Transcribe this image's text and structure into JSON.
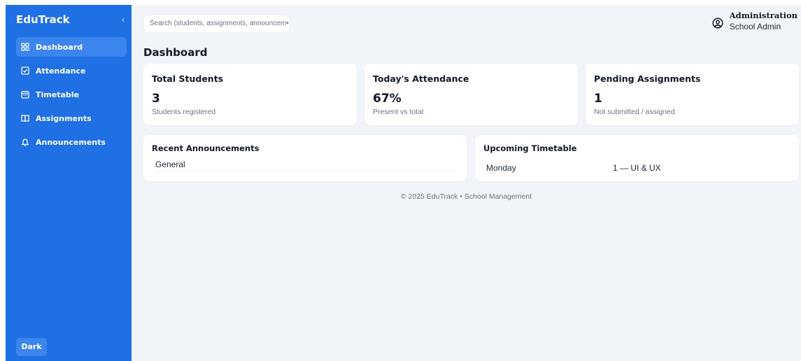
{
  "sidebar": {
    "brand": "EduTrack",
    "collapse_icon": "‹",
    "items": [
      {
        "label": "Dashboard",
        "icon": "grid-icon",
        "active": true
      },
      {
        "label": "Attendance",
        "icon": "checkbox-icon",
        "active": false
      },
      {
        "label": "Timetable",
        "icon": "calendar-icon",
        "active": false
      },
      {
        "label": "Assignments",
        "icon": "book-icon",
        "active": false
      },
      {
        "label": "Announcements",
        "icon": "bell-icon",
        "active": false
      }
    ],
    "theme_toggle": "Dark"
  },
  "header": {
    "search_placeholder": "Search (students, assignments, announcem•",
    "user_name": "Administration",
    "user_role": "School Admin",
    "user_icon": "user-circle-icon"
  },
  "main": {
    "title": "Dashboard",
    "stats": [
      {
        "title": "Total Students",
        "value": "3",
        "sub": "Students registered"
      },
      {
        "title": "Today's Attendance",
        "value": "67%",
        "sub": "Present vs total"
      },
      {
        "title": "Pending Assignments",
        "value": "1",
        "sub": "Not submitted / assigned"
      }
    ],
    "announcements": {
      "title": "Recent Announcements",
      "items": [
        "General"
      ]
    },
    "timetable": {
      "title": "Upcoming Timetable",
      "rows": [
        {
          "day": "Monday",
          "detail": "1 — UI & UX"
        }
      ]
    }
  },
  "footer": {
    "text": "© 2025 EduTrack • School Management"
  },
  "colors": {
    "sidebar_bg": "#1f6fe5",
    "sidebar_active": "#3d85ee",
    "main_bg": "#f1f4f8",
    "card_bg": "#ffffff"
  }
}
